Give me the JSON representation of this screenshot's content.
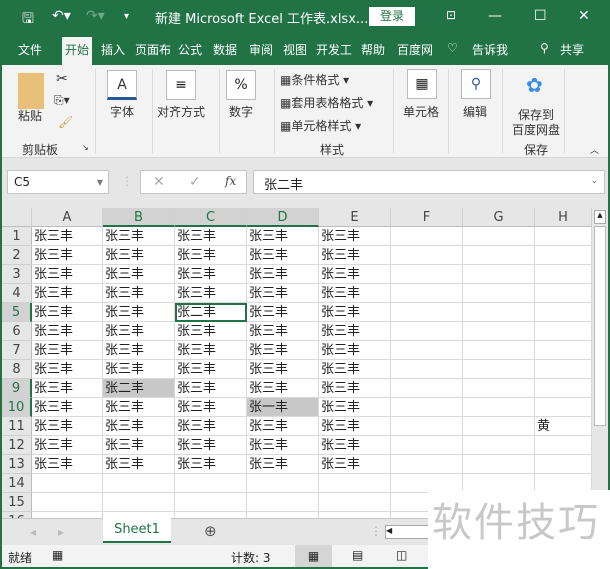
{
  "titlebar": {
    "title": "新建 Microsoft Excel 工作表.xlsx...",
    "login": "登录",
    "save_icon": "save-icon",
    "undo_icon": "undo-icon",
    "redo_icon": "redo-icon"
  },
  "tabs": [
    "文件",
    "开始",
    "插入",
    "页面布",
    "公式",
    "数据",
    "审阅",
    "视图",
    "开发工",
    "帮助",
    "百度网"
  ],
  "active_tab": "开始",
  "tellme": "告诉我",
  "share": "共享",
  "ribbon": {
    "paste": "粘贴",
    "clipboard": "剪贴板",
    "font": "字体",
    "align": "对齐方式",
    "number": "数字",
    "cond": "条件格式",
    "table": "套用表格格式",
    "cellstyle": "单元格样式",
    "styles": "样式",
    "cells": "单元格",
    "edit": "编辑",
    "baidu_save": "保存到",
    "baidu_save2": "百度网盘",
    "save_group": "保存"
  },
  "formula": {
    "namebox": "C5",
    "fx": "fx",
    "value": "张二丰"
  },
  "columns": [
    "A",
    "B",
    "C",
    "D",
    "E",
    "F",
    "G",
    "H"
  ],
  "selected_columns": [
    "B",
    "C",
    "D"
  ],
  "selected_rows": [
    5,
    9,
    10
  ],
  "rows": [
    [
      "张三丰",
      "张三丰",
      "张三丰",
      "张三丰",
      "张三丰",
      "",
      "",
      ""
    ],
    [
      "张三丰",
      "张三丰",
      "张三丰",
      "张三丰",
      "张三丰",
      "",
      "",
      ""
    ],
    [
      "张三丰",
      "张三丰",
      "张三丰",
      "张三丰",
      "张三丰",
      "",
      "",
      ""
    ],
    [
      "张三丰",
      "张三丰",
      "张三丰",
      "张三丰",
      "张三丰",
      "",
      "",
      ""
    ],
    [
      "张三丰",
      "张三丰",
      "张二丰",
      "张三丰",
      "张三丰",
      "",
      "",
      ""
    ],
    [
      "张三丰",
      "张三丰",
      "张三丰",
      "张三丰",
      "张三丰",
      "",
      "",
      ""
    ],
    [
      "张三丰",
      "张三丰",
      "张三丰",
      "张三丰",
      "张三丰",
      "",
      "",
      ""
    ],
    [
      "张三丰",
      "张三丰",
      "张三丰",
      "张三丰",
      "张三丰",
      "",
      "",
      ""
    ],
    [
      "张三丰",
      "张二丰",
      "张三丰",
      "张三丰",
      "张三丰",
      "",
      "",
      ""
    ],
    [
      "张三丰",
      "张三丰",
      "张三丰",
      "张一丰",
      "张三丰",
      "",
      "",
      ""
    ],
    [
      "张三丰",
      "张三丰",
      "张三丰",
      "张三丰",
      "张三丰",
      "",
      "",
      "黄"
    ],
    [
      "张三丰",
      "张三丰",
      "张三丰",
      "张三丰",
      "张三丰",
      "",
      "",
      ""
    ],
    [
      "张三丰",
      "张三丰",
      "张三丰",
      "张三丰",
      "张三丰",
      "",
      "",
      ""
    ],
    [
      "",
      "",
      "",
      "",
      "",
      "",
      "",
      ""
    ],
    [
      "",
      "",
      "",
      "",
      "",
      "",
      "",
      ""
    ],
    [
      "",
      "",
      "",
      "",
      "",
      "",
      "",
      ""
    ]
  ],
  "sheet_tab": "Sheet1",
  "status": {
    "ready": "就绪",
    "count": "计数: 3"
  },
  "watermark": "软件技巧"
}
